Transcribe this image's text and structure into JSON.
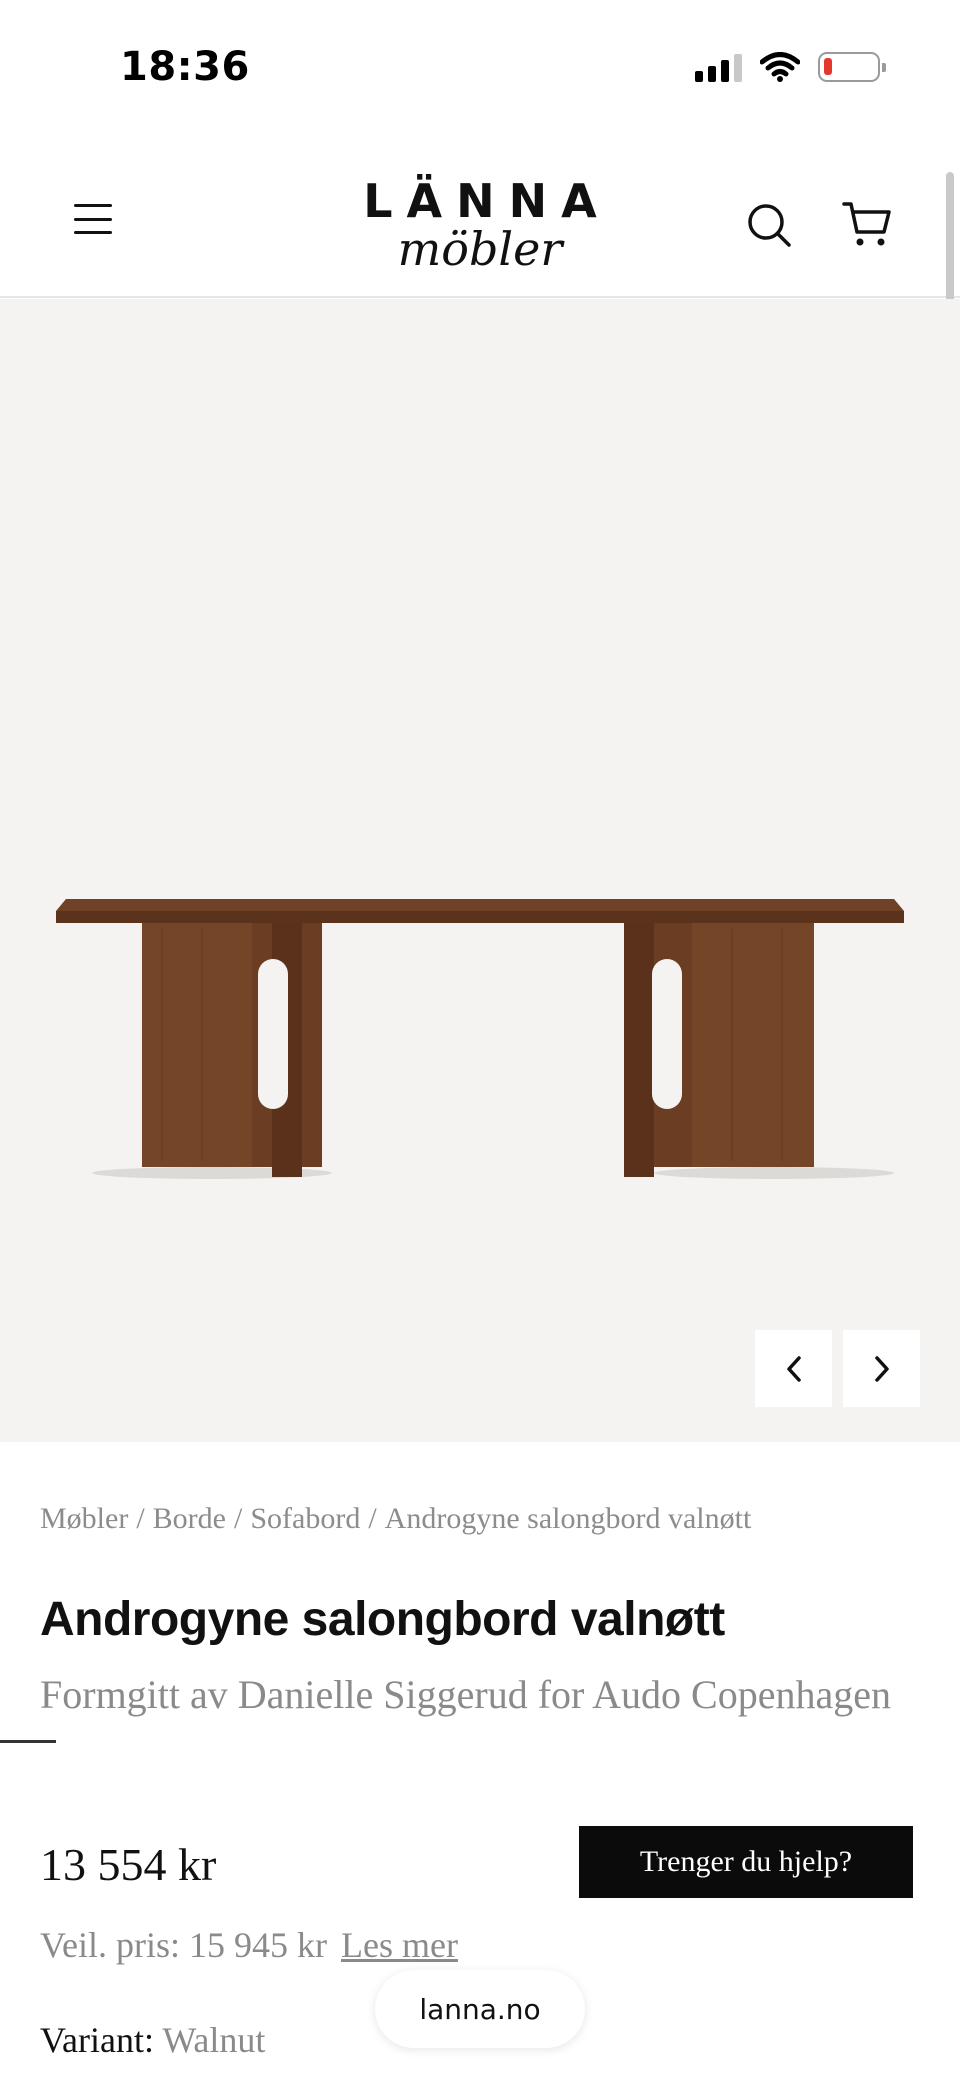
{
  "status_bar": {
    "time": "18:36",
    "icons": [
      "cellular-signal-icon",
      "wifi-icon",
      "battery-low-icon"
    ]
  },
  "header": {
    "logo_top": "LÄNNA",
    "logo_bottom": "möbler",
    "icons": [
      "hamburger-menu-icon",
      "search-icon",
      "cart-icon"
    ]
  },
  "gallery": {
    "image_alt": "Walnut coffee table with two slab legs",
    "controls": [
      "chevron-left-icon",
      "chevron-right-icon"
    ]
  },
  "breadcrumb": [
    "Møbler",
    "Borde",
    "Sofabord",
    "Androgyne salongbord valnøtt"
  ],
  "breadcrumb_separator": "/",
  "product": {
    "title": "Androgyne salongbord valnøtt",
    "subtitle": "Formgitt av Danielle Siggerud for Audo Copenhagen",
    "price": "13 554 kr",
    "rrp_label": "Veil. pris: 15 945 kr",
    "read_more": "Les mer",
    "variant_label": "Variant:",
    "variant_value": "Walnut"
  },
  "help_button": "Trenger du hjelp?",
  "browser": {
    "url": "lanna.no"
  },
  "colors": {
    "gallery_bg": "#f4f3f1",
    "wood": "#6b3f25",
    "help_bg": "#0b0b0b",
    "muted_text": "#8a8a8a",
    "battery_low": "#e6372d"
  }
}
